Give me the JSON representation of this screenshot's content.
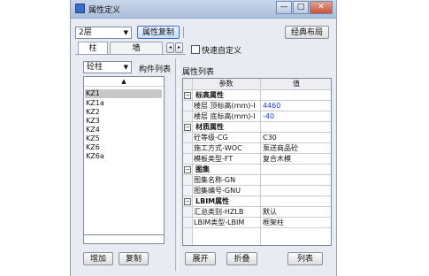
{
  "window": {
    "title": "属性定义"
  },
  "floor_select": "2层",
  "buttons": {
    "copy_props": "属性复制",
    "classic_layout": "经典布局",
    "add": "增加",
    "copy": "复制",
    "expand": "展开",
    "collapse": "折叠",
    "list": "列表"
  },
  "tabs": [
    "柱",
    "墙"
  ],
  "quick_define": "快速自定义",
  "type_select": "砼柱",
  "component_list_label": "构件列表",
  "components": [
    "KZ1",
    "KZ1a",
    "KZ2",
    "KZ3",
    "KZ4",
    "KZ5",
    "KZ6",
    "KZ6a"
  ],
  "prop_list_label": "属性列表",
  "grid": {
    "col_param": "参数",
    "col_value": "值",
    "groups": [
      {
        "name": "标高属性",
        "rows": [
          {
            "param": "楼层 顶标高(mm)-I",
            "value": "4460",
            "blue": true
          },
          {
            "param": "楼层 底标高(mm)-I",
            "value": "-40",
            "blue": true
          }
        ]
      },
      {
        "name": "材质属性",
        "rows": [
          {
            "param": "砼等级-CG",
            "value": "C30"
          },
          {
            "param": "施工方式-WOC",
            "value": "泵送商品砼"
          },
          {
            "param": "模板类型-FT",
            "value": "复合木模"
          }
        ]
      },
      {
        "name": "图集",
        "rows": [
          {
            "param": "图集名称-GN",
            "value": ""
          },
          {
            "param": "图集编号-GNU",
            "value": ""
          }
        ]
      },
      {
        "name": "LBIM属性",
        "rows": [
          {
            "param": "汇总类别-HZLB",
            "value": "默认"
          },
          {
            "param": "LBIM类型-LBIM",
            "value": "框架柱"
          }
        ]
      }
    ]
  },
  "colors": {
    "blue_value": "#1a3fd6",
    "title_bar": "#b7c7e2",
    "selection": "#c8c8c8"
  }
}
